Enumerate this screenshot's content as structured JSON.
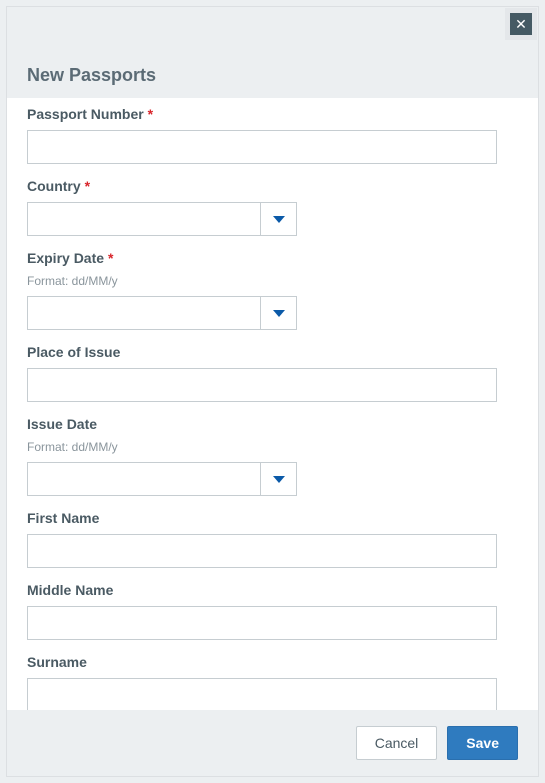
{
  "modal": {
    "title": "New Passports",
    "fields": {
      "passport_number": {
        "label": "Passport Number",
        "required": true,
        "value": ""
      },
      "country": {
        "label": "Country",
        "required": true,
        "value": ""
      },
      "expiry_date": {
        "label": "Expiry Date",
        "required": true,
        "hint": "Format: dd/MM/y",
        "value": ""
      },
      "place_of_issue": {
        "label": "Place of Issue",
        "required": false,
        "value": ""
      },
      "issue_date": {
        "label": "Issue Date",
        "required": false,
        "hint": "Format: dd/MM/y",
        "value": ""
      },
      "first_name": {
        "label": "First Name",
        "required": false,
        "value": ""
      },
      "middle_name": {
        "label": "Middle Name",
        "required": false,
        "value": ""
      },
      "surname": {
        "label": "Surname",
        "required": false,
        "value": ""
      }
    },
    "buttons": {
      "cancel": "Cancel",
      "save": "Save"
    },
    "required_marker": "*"
  }
}
